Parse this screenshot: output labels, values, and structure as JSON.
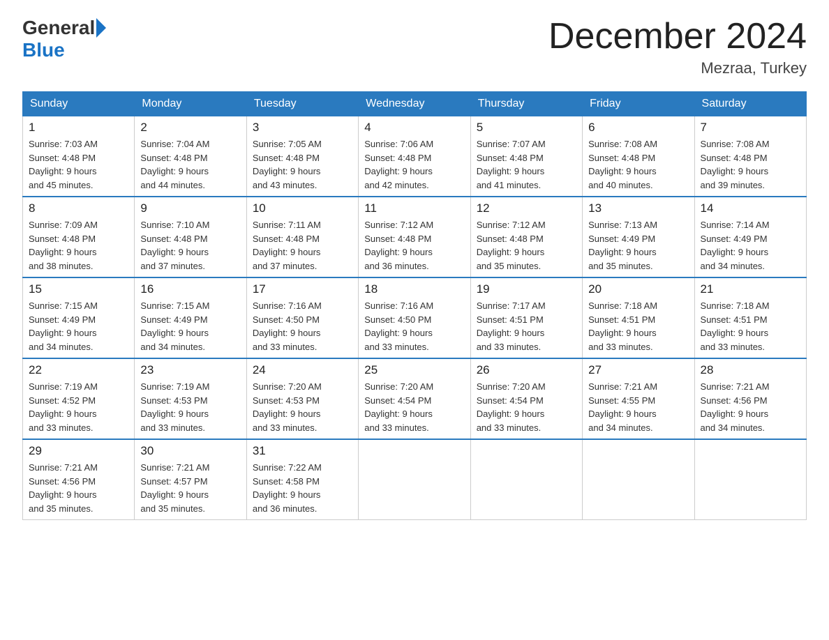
{
  "header": {
    "logo_general": "General",
    "logo_blue": "Blue",
    "title": "December 2024",
    "location": "Mezraa, Turkey"
  },
  "days_of_week": [
    "Sunday",
    "Monday",
    "Tuesday",
    "Wednesday",
    "Thursday",
    "Friday",
    "Saturday"
  ],
  "weeks": [
    [
      {
        "day": "1",
        "sunrise": "7:03 AM",
        "sunset": "4:48 PM",
        "daylight": "9 hours and 45 minutes."
      },
      {
        "day": "2",
        "sunrise": "7:04 AM",
        "sunset": "4:48 PM",
        "daylight": "9 hours and 44 minutes."
      },
      {
        "day": "3",
        "sunrise": "7:05 AM",
        "sunset": "4:48 PM",
        "daylight": "9 hours and 43 minutes."
      },
      {
        "day": "4",
        "sunrise": "7:06 AM",
        "sunset": "4:48 PM",
        "daylight": "9 hours and 42 minutes."
      },
      {
        "day": "5",
        "sunrise": "7:07 AM",
        "sunset": "4:48 PM",
        "daylight": "9 hours and 41 minutes."
      },
      {
        "day": "6",
        "sunrise": "7:08 AM",
        "sunset": "4:48 PM",
        "daylight": "9 hours and 40 minutes."
      },
      {
        "day": "7",
        "sunrise": "7:08 AM",
        "sunset": "4:48 PM",
        "daylight": "9 hours and 39 minutes."
      }
    ],
    [
      {
        "day": "8",
        "sunrise": "7:09 AM",
        "sunset": "4:48 PM",
        "daylight": "9 hours and 38 minutes."
      },
      {
        "day": "9",
        "sunrise": "7:10 AM",
        "sunset": "4:48 PM",
        "daylight": "9 hours and 37 minutes."
      },
      {
        "day": "10",
        "sunrise": "7:11 AM",
        "sunset": "4:48 PM",
        "daylight": "9 hours and 37 minutes."
      },
      {
        "day": "11",
        "sunrise": "7:12 AM",
        "sunset": "4:48 PM",
        "daylight": "9 hours and 36 minutes."
      },
      {
        "day": "12",
        "sunrise": "7:12 AM",
        "sunset": "4:48 PM",
        "daylight": "9 hours and 35 minutes."
      },
      {
        "day": "13",
        "sunrise": "7:13 AM",
        "sunset": "4:49 PM",
        "daylight": "9 hours and 35 minutes."
      },
      {
        "day": "14",
        "sunrise": "7:14 AM",
        "sunset": "4:49 PM",
        "daylight": "9 hours and 34 minutes."
      }
    ],
    [
      {
        "day": "15",
        "sunrise": "7:15 AM",
        "sunset": "4:49 PM",
        "daylight": "9 hours and 34 minutes."
      },
      {
        "day": "16",
        "sunrise": "7:15 AM",
        "sunset": "4:49 PM",
        "daylight": "9 hours and 34 minutes."
      },
      {
        "day": "17",
        "sunrise": "7:16 AM",
        "sunset": "4:50 PM",
        "daylight": "9 hours and 33 minutes."
      },
      {
        "day": "18",
        "sunrise": "7:16 AM",
        "sunset": "4:50 PM",
        "daylight": "9 hours and 33 minutes."
      },
      {
        "day": "19",
        "sunrise": "7:17 AM",
        "sunset": "4:51 PM",
        "daylight": "9 hours and 33 minutes."
      },
      {
        "day": "20",
        "sunrise": "7:18 AM",
        "sunset": "4:51 PM",
        "daylight": "9 hours and 33 minutes."
      },
      {
        "day": "21",
        "sunrise": "7:18 AM",
        "sunset": "4:51 PM",
        "daylight": "9 hours and 33 minutes."
      }
    ],
    [
      {
        "day": "22",
        "sunrise": "7:19 AM",
        "sunset": "4:52 PM",
        "daylight": "9 hours and 33 minutes."
      },
      {
        "day": "23",
        "sunrise": "7:19 AM",
        "sunset": "4:53 PM",
        "daylight": "9 hours and 33 minutes."
      },
      {
        "day": "24",
        "sunrise": "7:20 AM",
        "sunset": "4:53 PM",
        "daylight": "9 hours and 33 minutes."
      },
      {
        "day": "25",
        "sunrise": "7:20 AM",
        "sunset": "4:54 PM",
        "daylight": "9 hours and 33 minutes."
      },
      {
        "day": "26",
        "sunrise": "7:20 AM",
        "sunset": "4:54 PM",
        "daylight": "9 hours and 33 minutes."
      },
      {
        "day": "27",
        "sunrise": "7:21 AM",
        "sunset": "4:55 PM",
        "daylight": "9 hours and 34 minutes."
      },
      {
        "day": "28",
        "sunrise": "7:21 AM",
        "sunset": "4:56 PM",
        "daylight": "9 hours and 34 minutes."
      }
    ],
    [
      {
        "day": "29",
        "sunrise": "7:21 AM",
        "sunset": "4:56 PM",
        "daylight": "9 hours and 35 minutes."
      },
      {
        "day": "30",
        "sunrise": "7:21 AM",
        "sunset": "4:57 PM",
        "daylight": "9 hours and 35 minutes."
      },
      {
        "day": "31",
        "sunrise": "7:22 AM",
        "sunset": "4:58 PM",
        "daylight": "9 hours and 36 minutes."
      },
      null,
      null,
      null,
      null
    ]
  ],
  "labels": {
    "sunrise": "Sunrise:",
    "sunset": "Sunset:",
    "daylight": "Daylight:"
  }
}
